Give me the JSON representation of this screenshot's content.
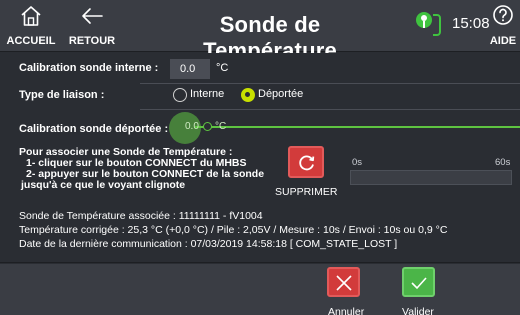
{
  "header": {
    "home_label": "ACCUEIL",
    "back_label": "RETOUR",
    "title": "Sonde de Température",
    "time": "15:08",
    "help_label": "AIDE"
  },
  "calibration_internal": {
    "label": "Calibration sonde interne :",
    "value": "0.0",
    "unit": "°C"
  },
  "link_type": {
    "label": "Type de liaison :",
    "options": [
      {
        "label": "Interne",
        "selected": false
      },
      {
        "label": "Déportée",
        "selected": true
      }
    ]
  },
  "calibration_remote": {
    "label": "Calibration sonde déportée :",
    "value": "0.0",
    "unit": "°C"
  },
  "instructions": {
    "line1": "Pour associer une Sonde de Température :",
    "line2": "1- cliquer sur le bouton CONNECT du MHBS",
    "line3": "2- appuyer sur le bouton CONNECT de la sonde",
    "line4": "jusqu'à ce que le voyant clignote"
  },
  "delete_button": {
    "label": "SUPPRIMER",
    "icon": "refresh-icon"
  },
  "progress": {
    "start_label": "0s",
    "end_label": "60s",
    "fraction": 0.0
  },
  "info": {
    "line1": "Sonde de Température associée : 11111111 - fV1004",
    "line2": "Température corrigée : 25,3 °C (+0,0 °C) / Pile : 2,05V / Mesure : 10s / Envoi : 10s ou 0,9 °C",
    "line3": "Date de la dernière communication : 07/03/2019 14:58:18  [ COM_STATE_LOST ]"
  },
  "footer": {
    "cancel_label": "Annuler",
    "ok_label": "Valider"
  },
  "colors": {
    "accent_green": "#5ec441",
    "radio_selected": "#c8e000",
    "danger_red": "#d23b3b",
    "confirm_green": "#4bb548"
  }
}
